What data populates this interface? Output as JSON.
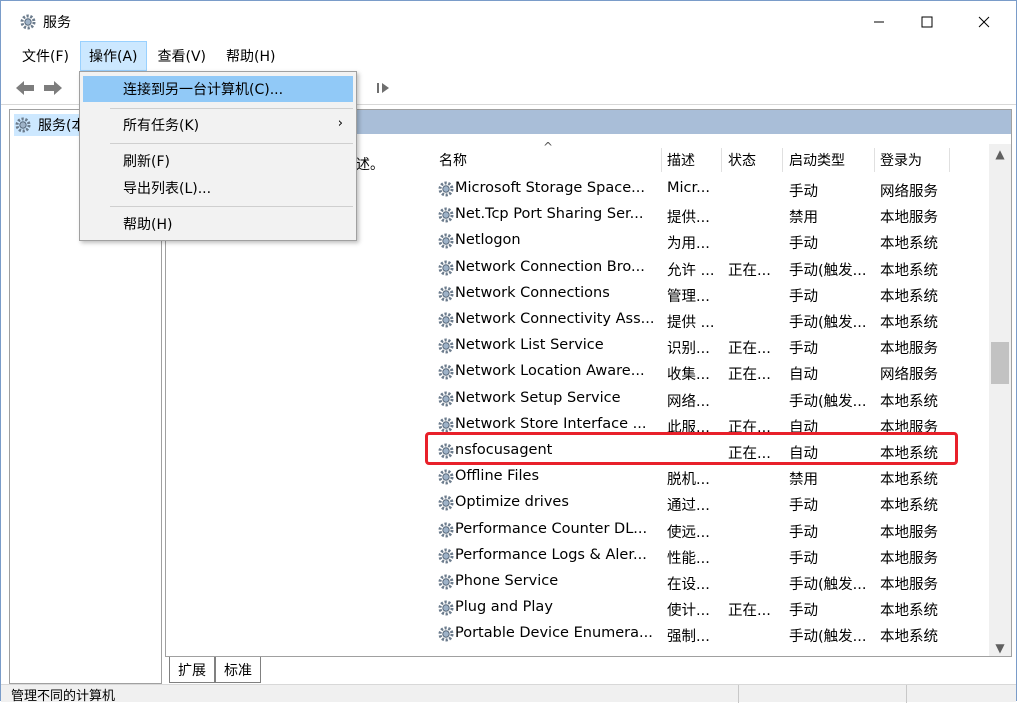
{
  "window": {
    "title": "服务",
    "minimize": "—",
    "maximize": "☐",
    "close": "✕"
  },
  "menubar": [
    "文件(F)",
    "操作(A)",
    "查看(V)",
    "帮助(H)"
  ],
  "action_menu": {
    "items": [
      "连接到另一台计算机(C)...",
      "所有任务(K)",
      "刷新(F)",
      "导出列表(L)...",
      "帮助(H)"
    ],
    "submenu_arrow": "›"
  },
  "tree": {
    "root_label": "服务(本"
  },
  "right_pane": {
    "desc_fragment": "述。"
  },
  "columns": [
    "名称",
    "描述",
    "状态",
    "启动类型",
    "登录为"
  ],
  "sort_arrow": "^",
  "services": [
    {
      "name": "Microsoft Storage Space...",
      "desc": "Micr...",
      "status": "",
      "startup": "手动",
      "logon": "网络服务"
    },
    {
      "name": "Net.Tcp Port Sharing Ser...",
      "desc": "提供...",
      "status": "",
      "startup": "禁用",
      "logon": "本地服务"
    },
    {
      "name": "Netlogon",
      "desc": "为用...",
      "status": "",
      "startup": "手动",
      "logon": "本地系统"
    },
    {
      "name": "Network Connection Bro...",
      "desc": "允许 ...",
      "status": "正在...",
      "startup": "手动(触发...",
      "logon": "本地系统"
    },
    {
      "name": "Network Connections",
      "desc": "管理...",
      "status": "",
      "startup": "手动",
      "logon": "本地系统"
    },
    {
      "name": "Network Connectivity Ass...",
      "desc": "提供 ...",
      "status": "",
      "startup": "手动(触发...",
      "logon": "本地系统"
    },
    {
      "name": "Network List Service",
      "desc": "识别...",
      "status": "正在...",
      "startup": "手动",
      "logon": "本地服务"
    },
    {
      "name": "Network Location Aware...",
      "desc": "收集...",
      "status": "正在...",
      "startup": "自动",
      "logon": "网络服务"
    },
    {
      "name": "Network Setup Service",
      "desc": "网络...",
      "status": "",
      "startup": "手动(触发...",
      "logon": "本地系统"
    },
    {
      "name": "Network Store Interface ...",
      "desc": "此服...",
      "status": "正在...",
      "startup": "自动",
      "logon": "本地服务"
    },
    {
      "name": "nsfocusagent",
      "desc": "",
      "status": "正在...",
      "startup": "自动",
      "logon": "本地系统"
    },
    {
      "name": "Offline Files",
      "desc": "脱机...",
      "status": "",
      "startup": "禁用",
      "logon": "本地系统"
    },
    {
      "name": "Optimize drives",
      "desc": "通过...",
      "status": "",
      "startup": "手动",
      "logon": "本地系统"
    },
    {
      "name": "Performance Counter DL...",
      "desc": "使远...",
      "status": "",
      "startup": "手动",
      "logon": "本地服务"
    },
    {
      "name": "Performance Logs & Aler...",
      "desc": "性能...",
      "status": "",
      "startup": "手动",
      "logon": "本地服务"
    },
    {
      "name": "Phone Service",
      "desc": "在设...",
      "status": "",
      "startup": "手动(触发...",
      "logon": "本地服务"
    },
    {
      "name": "Plug and Play",
      "desc": "使计...",
      "status": "正在...",
      "startup": "手动",
      "logon": "本地系统"
    },
    {
      "name": "Portable Device Enumera...",
      "desc": "强制...",
      "status": "",
      "startup": "手动(触发...",
      "logon": "本地系统"
    }
  ],
  "tabs": [
    "扩展",
    "标准"
  ],
  "statusbar": {
    "text": "管理不同的计算机"
  },
  "scroll": {
    "up": "▲",
    "down": "▼"
  },
  "colors": {
    "highlight_box": "#e8202a",
    "menu_highlight": "#91c9f7",
    "header_band": "#a9bed8"
  }
}
